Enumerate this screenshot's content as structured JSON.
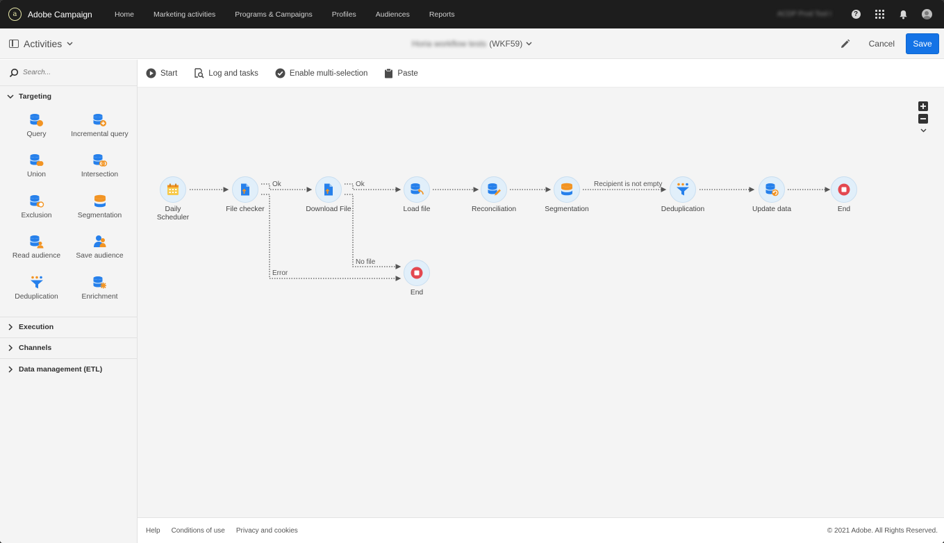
{
  "topbar": {
    "app_name": "Adobe Campaign",
    "nav": [
      "Home",
      "Marketing activities",
      "Programs & Campaigns",
      "Profiles",
      "Audiences",
      "Reports"
    ],
    "org_name": "ACDP Prod Tool I"
  },
  "header": {
    "activities_label": "Activities",
    "workflow_name": "Horia workflow tests",
    "workflow_id": "(WKF59)",
    "cancel_label": "Cancel",
    "save_label": "Save"
  },
  "sidebar": {
    "search_placeholder": "Search...",
    "targeting_label": "Targeting",
    "activities": [
      {
        "label": "Query",
        "icon": "query-icon"
      },
      {
        "label": "Incremental query",
        "icon": "incremental-query-icon"
      },
      {
        "label": "Union",
        "icon": "union-icon"
      },
      {
        "label": "Intersection",
        "icon": "intersection-icon"
      },
      {
        "label": "Exclusion",
        "icon": "exclusion-icon"
      },
      {
        "label": "Segmentation",
        "icon": "segmentation-icon"
      },
      {
        "label": "Read audience",
        "icon": "read-audience-icon"
      },
      {
        "label": "Save audience",
        "icon": "save-audience-icon"
      },
      {
        "label": "Deduplication",
        "icon": "deduplication-icon"
      },
      {
        "label": "Enrichment",
        "icon": "enrichment-icon"
      }
    ],
    "sections": [
      "Execution",
      "Channels",
      "Data management (ETL)"
    ]
  },
  "toolbar": {
    "start": "Start",
    "log": "Log and tasks",
    "multi": "Enable multi-selection",
    "paste": "Paste"
  },
  "workflow": {
    "nodes": [
      "Daily Scheduler",
      "File checker",
      "Download File",
      "Load file",
      "Reconciliation",
      "Segmentation",
      "Deduplication",
      "Update data",
      "End",
      "End"
    ],
    "edge_labels": [
      "Ok",
      "Ok",
      "Recipient is not empty",
      "No file",
      "Error"
    ]
  },
  "footer": {
    "links": [
      "Help",
      "Conditions of use",
      "Privacy and cookies"
    ],
    "copyright": "© 2021 Adobe. All Rights Reserved."
  },
  "colors": {
    "topbar": "#1d1d1d",
    "save_button": "#1473e6",
    "node_circle": "#e1effa",
    "db_icon": "#2680eb",
    "accent_orange": "#f29423",
    "end_red": "#e34850"
  }
}
